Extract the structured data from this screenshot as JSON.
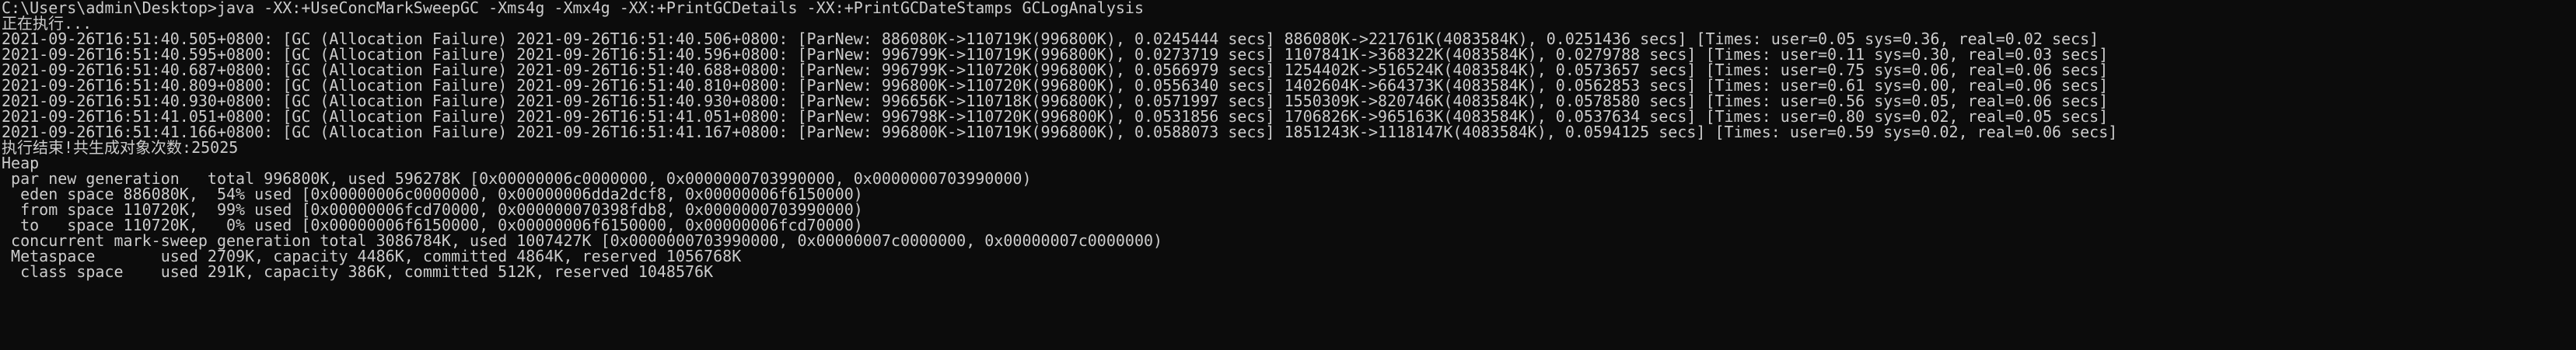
{
  "console": {
    "lines": [
      "C:\\Users\\admin\\Desktop>java -XX:+UseConcMarkSweepGC -Xms4g -Xmx4g -XX:+PrintGCDetails -XX:+PrintGCDateStamps GCLogAnalysis",
      "正在执行...",
      "2021-09-26T16:51:40.505+0800: [GC (Allocation Failure) 2021-09-26T16:51:40.506+0800: [ParNew: 886080K->110719K(996800K), 0.0245444 secs] 886080K->221761K(4083584K), 0.0251436 secs] [Times: user=0.05 sys=0.36, real=0.02 secs]",
      "2021-09-26T16:51:40.595+0800: [GC (Allocation Failure) 2021-09-26T16:51:40.596+0800: [ParNew: 996799K->110719K(996800K), 0.0273719 secs] 1107841K->368322K(4083584K), 0.0279788 secs] [Times: user=0.11 sys=0.30, real=0.03 secs]",
      "2021-09-26T16:51:40.687+0800: [GC (Allocation Failure) 2021-09-26T16:51:40.688+0800: [ParNew: 996799K->110720K(996800K), 0.0566979 secs] 1254402K->516524K(4083584K), 0.0573657 secs] [Times: user=0.75 sys=0.06, real=0.06 secs]",
      "2021-09-26T16:51:40.809+0800: [GC (Allocation Failure) 2021-09-26T16:51:40.810+0800: [ParNew: 996800K->110720K(996800K), 0.0556340 secs] 1402604K->664373K(4083584K), 0.0562853 secs] [Times: user=0.61 sys=0.00, real=0.06 secs]",
      "2021-09-26T16:51:40.930+0800: [GC (Allocation Failure) 2021-09-26T16:51:40.930+0800: [ParNew: 996656K->110718K(996800K), 0.0571997 secs] 1550309K->820746K(4083584K), 0.0578580 secs] [Times: user=0.56 sys=0.05, real=0.06 secs]",
      "2021-09-26T16:51:41.051+0800: [GC (Allocation Failure) 2021-09-26T16:51:41.051+0800: [ParNew: 996798K->110720K(996800K), 0.0531856 secs] 1706826K->965163K(4083584K), 0.0537634 secs] [Times: user=0.80 sys=0.02, real=0.05 secs]",
      "2021-09-26T16:51:41.166+0800: [GC (Allocation Failure) 2021-09-26T16:51:41.167+0800: [ParNew: 996800K->110719K(996800K), 0.0588073 secs] 1851243K->1118147K(4083584K), 0.0594125 secs] [Times: user=0.59 sys=0.02, real=0.06 secs]",
      "执行结束!共生成对象次数:25025",
      "Heap",
      " par new generation   total 996800K, used 596278K [0x00000006c0000000, 0x0000000703990000, 0x0000000703990000)",
      "  eden space 886080K,  54% used [0x00000006c0000000, 0x00000006dda2dcf8, 0x00000006f6150000)",
      "  from space 110720K,  99% used [0x00000006fcd70000, 0x000000070398fdb8, 0x0000000703990000)",
      "  to   space 110720K,   0% used [0x00000006f6150000, 0x00000006f6150000, 0x00000006fcd70000)",
      " concurrent mark-sweep generation total 3086784K, used 1007427K [0x0000000703990000, 0x00000007c0000000, 0x00000007c0000000)",
      " Metaspace       used 2709K, capacity 4486K, committed 4864K, reserved 1056768K",
      "  class space    used 291K, capacity 386K, committed 512K, reserved 1048576K"
    ]
  }
}
